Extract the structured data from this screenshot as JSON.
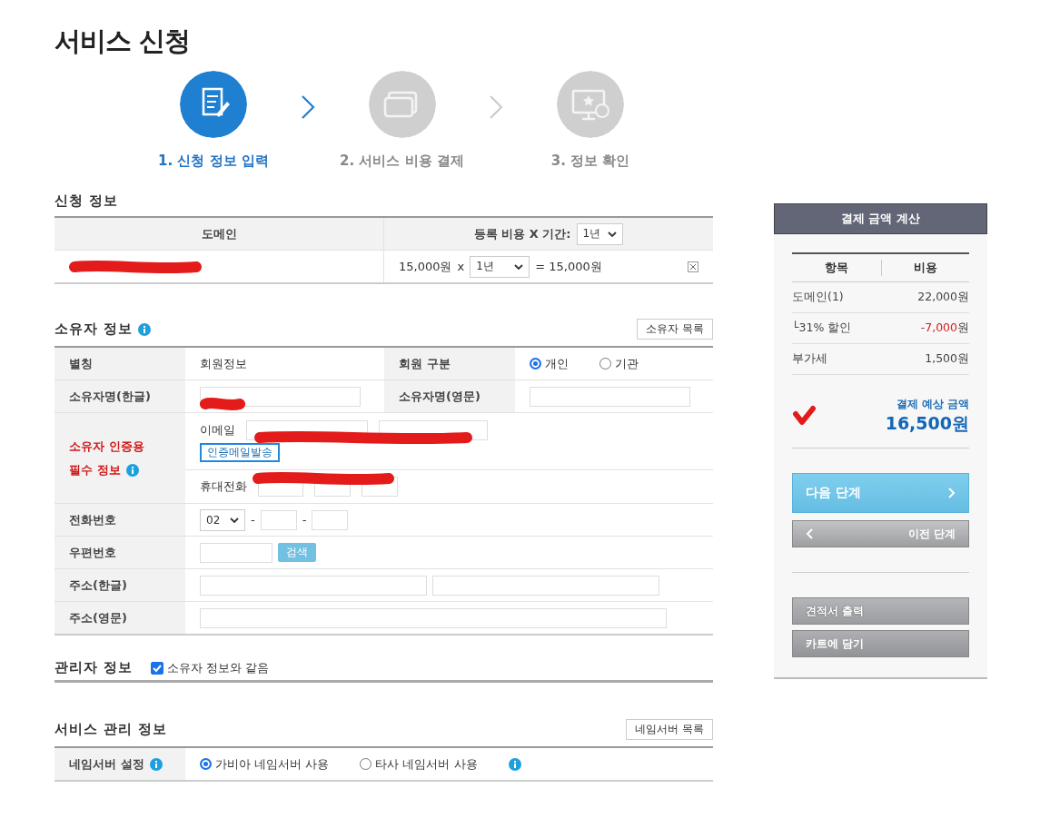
{
  "title": "서비스 신청",
  "steps": [
    {
      "label": "1. 신청 정보 입력",
      "selected": true
    },
    {
      "label": "2. 서비스 비용 결제",
      "selected": false
    },
    {
      "label": "3. 정보 확인",
      "selected": false
    }
  ],
  "order": {
    "title": "신청 정보",
    "domain_header": "도메인",
    "period_header": "등록 비용 X 기간:",
    "period_all": "1년",
    "price": "15,000원",
    "times": "x",
    "period": "1년",
    "total": "= 15,000원"
  },
  "owner": {
    "title": "소유자 정보",
    "list_button": "소유자 목록",
    "alias": {
      "label": "별칭",
      "value": "회원정보"
    },
    "member_type": {
      "label": "회원 구분",
      "options": [
        {
          "label": "개인",
          "selected": true
        },
        {
          "label": "기관",
          "selected": false
        }
      ]
    },
    "name_kr": {
      "label": "소유자명(한글)"
    },
    "name_en": {
      "label": "소유자명(영문)"
    },
    "verify": {
      "label_lines": [
        "소유자 인증용",
        "필수 정보"
      ],
      "email_label": "이메일",
      "send_button": "인증메일발송",
      "mobile_label": "휴대전화"
    },
    "phone": {
      "label": "전화번호",
      "area": "02",
      "separators": [
        "-",
        "-"
      ]
    },
    "zip": {
      "label": "우편번호",
      "search_button": "검색"
    },
    "addr_kr": {
      "label": "주소(한글)"
    },
    "addr_en": {
      "label": "주소(영문)"
    }
  },
  "admin": {
    "title": "관리자 정보",
    "same_as_owner": {
      "label": "소유자 정보와 같음",
      "checked": true
    }
  },
  "service": {
    "title": "서비스 관리 정보",
    "list_button": "네임서버 목록",
    "nameserver": {
      "label": "네임서버 설정",
      "options": [
        {
          "label": "가비아 네임서버 사용",
          "selected": true
        },
        {
          "label": "타사 네임서버 사용",
          "selected": false
        }
      ]
    }
  },
  "summary": {
    "title": "결제 금액 계산",
    "columns": [
      "항목",
      "비용"
    ],
    "rows": [
      {
        "item": "도메인(1)",
        "amount": "22,000",
        "unit": "원",
        "kind": "normal"
      },
      {
        "item": "└31% 할인",
        "amount": "-7,000",
        "unit": "원",
        "kind": "discount"
      },
      {
        "item": "부가세",
        "amount": "1,500",
        "unit": "원",
        "kind": "normal"
      }
    ],
    "total_label": "결제 예상 금액",
    "total": "16,500원",
    "next_button": "다음 단계",
    "prev_button": "이전 단계",
    "quote_button": "견적서 출력",
    "cart_button": "카트에 담기"
  }
}
